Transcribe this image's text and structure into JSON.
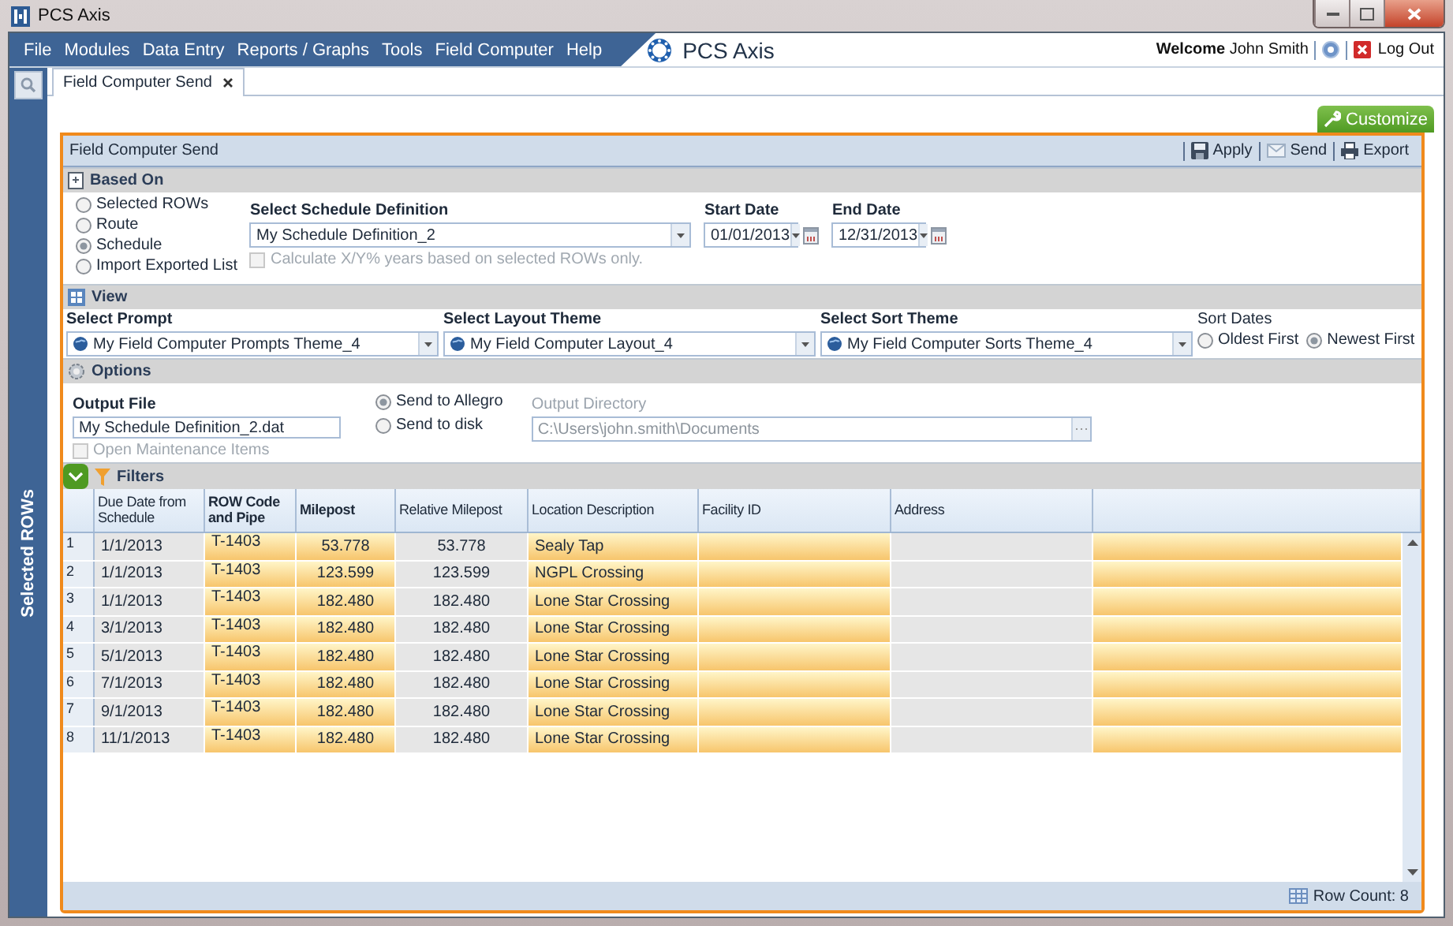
{
  "window": {
    "title": "PCS Axis"
  },
  "menu": [
    "File",
    "Modules",
    "Data Entry",
    "Reports / Graphs",
    "Tools",
    "Field Computer",
    "Help"
  ],
  "brand": "PCS Axis",
  "user": {
    "welcome": "Welcome",
    "name": "John Smith",
    "logout": "Log Out"
  },
  "side_rail": {
    "label": "Selected ROWs"
  },
  "tabs": [
    {
      "label": "Field Computer Send",
      "selected": true
    }
  ],
  "customize": "Customize",
  "panel": {
    "title": "Field Computer Send",
    "actions": [
      {
        "label": "Apply",
        "kind": "save"
      },
      {
        "label": "Send",
        "kind": "mail"
      },
      {
        "label": "Export",
        "kind": "print"
      }
    ]
  },
  "based_on": {
    "title": "Based On",
    "options": [
      {
        "label": "Selected ROWs",
        "selected": false
      },
      {
        "label": "Route",
        "selected": false
      },
      {
        "label": "Schedule",
        "selected": true
      },
      {
        "label": "Import Exported List",
        "selected": false
      }
    ],
    "schedule_label": "Select Schedule Definition",
    "schedule_value": "My Schedule Definition_2",
    "start_label": "Start Date",
    "start_value": "01/01/2013",
    "end_label": "End Date",
    "end_value": "12/31/2013",
    "calc": {
      "label": "Calculate X/Y% years based on selected ROWs only.",
      "checked": false,
      "disabled": true
    }
  },
  "view": {
    "title": "View",
    "selects": [
      {
        "label": "Select Prompt",
        "value": "My Field Computer Prompts Theme_4"
      },
      {
        "label": "Select Layout Theme",
        "value": "My Field Computer Layout_4"
      },
      {
        "label": "Select Sort Theme",
        "value": "My Field Computer Sorts Theme_4"
      }
    ],
    "sort": {
      "label": "Sort Dates",
      "options": [
        {
          "label": "Oldest First",
          "selected": false
        },
        {
          "label": "Newest First",
          "selected": true
        }
      ]
    }
  },
  "options": {
    "title": "Options",
    "output_file_label": "Output File",
    "output_file": "My Schedule Definition_2.dat",
    "send": [
      {
        "label": "Send to Allegro",
        "selected": true
      },
      {
        "label": "Send to disk",
        "selected": false
      }
    ],
    "directory_label": "Output Directory",
    "directory": "C:\\Users\\john.smith\\Documents",
    "directory_disabled": true,
    "maintenance": {
      "label": "Open Maintenance Items",
      "checked": false,
      "disabled": true
    }
  },
  "filters": {
    "title": "Filters"
  },
  "table": {
    "columns": [
      {
        "label": "Due Date from Schedule",
        "bold": false,
        "highlighted": false,
        "kind": "text"
      },
      {
        "label": "ROW Code and Pipe",
        "bold": true,
        "highlighted": true,
        "kind": "code"
      },
      {
        "label": "Milepost",
        "bold": true,
        "highlighted": true,
        "kind": "number"
      },
      {
        "label": "Relative Milepost",
        "bold": false,
        "highlighted": false,
        "kind": "number"
      },
      {
        "label": "Location Description",
        "bold": false,
        "highlighted": true,
        "kind": "text"
      },
      {
        "label": "Facility ID",
        "bold": false,
        "highlighted": true,
        "kind": "text"
      },
      {
        "label": "Address",
        "bold": false,
        "highlighted": false,
        "kind": "text"
      },
      {
        "bold": false,
        "highlighted": true,
        "kind": "text"
      }
    ],
    "rows": [
      {
        "number": "1",
        "cells": [
          "1/1/2013",
          "T-1403",
          "53.778",
          "53.778",
          "Sealy Tap"
        ]
      },
      {
        "number": "2",
        "cells": [
          "1/1/2013",
          "T-1403",
          "123.599",
          "123.599",
          "NGPL Crossing"
        ]
      },
      {
        "number": "3",
        "cells": [
          "1/1/2013",
          "T-1403",
          "182.480",
          "182.480",
          "Lone Star Crossing"
        ]
      },
      {
        "number": "4",
        "cells": [
          "3/1/2013",
          "T-1403",
          "182.480",
          "182.480",
          "Lone Star Crossing"
        ]
      },
      {
        "number": "5",
        "cells": [
          "5/1/2013",
          "T-1403",
          "182.480",
          "182.480",
          "Lone Star Crossing"
        ]
      },
      {
        "number": "6",
        "cells": [
          "7/1/2013",
          "T-1403",
          "182.480",
          "182.480",
          "Lone Star Crossing"
        ]
      },
      {
        "number": "7",
        "cells": [
          "9/1/2013",
          "T-1403",
          "182.480",
          "182.480",
          "Lone Star Crossing"
        ]
      },
      {
        "number": "8",
        "cells": [
          "11/1/2013",
          "T-1403",
          "182.480",
          "182.480",
          "Lone Star Crossing"
        ]
      }
    ]
  },
  "status_bar": {
    "row_count": "Row Count: 8"
  }
}
